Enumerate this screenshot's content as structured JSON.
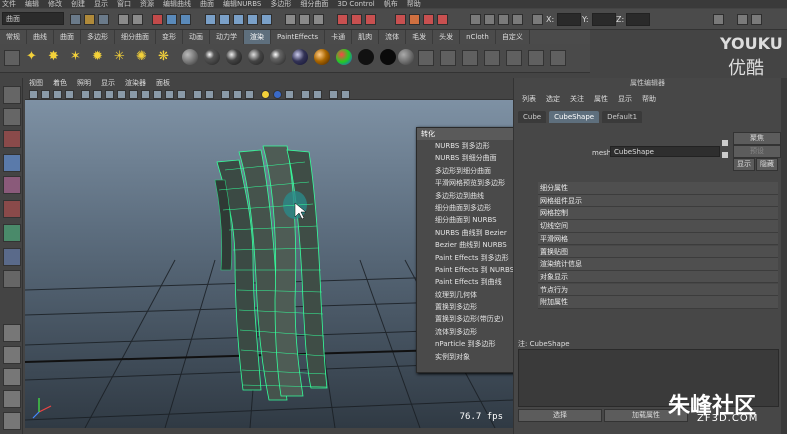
{
  "menubar": [
    "文件",
    "编辑",
    "修改",
    "创建",
    "显示",
    "窗口",
    "资源",
    "编辑曲线",
    "曲面",
    "编辑NURBS",
    "多边形",
    "细分曲面",
    "3D Control",
    "帆布",
    "帮助"
  ],
  "statusline": {
    "mode": "曲面",
    "x_label": "X:",
    "y_label": "Y:",
    "z_label": "Z:"
  },
  "shelf_tabs": [
    "常规",
    "曲线",
    "曲面",
    "多边形",
    "细分曲面",
    "变形",
    "动画",
    "动力学",
    "渲染",
    "PaintEffects",
    "卡通",
    "肌肉",
    "流体",
    "毛发",
    "头发",
    "nCloth",
    "自定义"
  ],
  "active_shelf_tab": "渲染",
  "panel_menu": [
    "视图",
    "着色",
    "照明",
    "显示",
    "渲染器",
    "面板"
  ],
  "viewport": {
    "fps": "76.7 fps"
  },
  "convert_menu": {
    "title": "转化",
    "close": "x",
    "items": [
      {
        "label": "NURBS 到多边形",
        "option": true
      },
      {
        "label": "NURBS 到细分曲面",
        "option": true
      },
      {
        "label": "多边形到细分曲面",
        "option": true
      },
      {
        "label": "平滑网格预览到多边形",
        "option": true
      },
      {
        "label": "多边形边到曲线",
        "option": true
      },
      {
        "label": "细分曲面到多边形",
        "option": true
      },
      {
        "label": "细分曲面到 NURBS",
        "option": true
      },
      {
        "label": "NURBS 曲线到 Bezier",
        "option": false
      },
      {
        "label": "Bezier 曲线到 NURBS",
        "option": false
      },
      {
        "label": "Paint Effects 到多边形",
        "option": true
      },
      {
        "label": "Paint Effects 到 NURBS",
        "option": true
      },
      {
        "label": "Paint Effects 到曲线",
        "option": true
      },
      {
        "label": "纹理到几何体",
        "option": true
      },
      {
        "label": "置换到多边形",
        "option": false
      },
      {
        "label": "置换到多边形(带历史)",
        "option": false
      },
      {
        "label": "流体到多边形",
        "option": false
      },
      {
        "label": "nParticle 到多边形",
        "option": true
      },
      {
        "label": "实例到对象",
        "option": false
      }
    ]
  },
  "attr_editor": {
    "title": "属性编辑器",
    "menu": [
      "列表",
      "选定",
      "关注",
      "属性",
      "显示",
      "帮助"
    ],
    "tabs": [
      "Cube",
      "CubeShape",
      "Default1"
    ],
    "active_tab": "CubeShape",
    "mesh_label": "mesh:",
    "mesh_value": "CubeShape",
    "focus_btn": "聚焦",
    "preset_btn": "预设",
    "show_btn": "显示",
    "hide_btn": "隐藏",
    "sections": [
      "细分属性",
      "网格组件显示",
      "网格控制",
      "切线空间",
      "平滑网格",
      "置换贴图",
      "渲染统计信息",
      "对象显示",
      "节点行为",
      "附加属性"
    ],
    "notes_label": "注: CubeShape",
    "select_btn": "选择",
    "load_btn": "加载属性"
  },
  "watermarks": {
    "youku_en": "YOUKU",
    "youku_cn": "优酷",
    "site_cn": "朱峰社区",
    "site_en": "ZF3D.COM"
  },
  "colors": {
    "accent": "#5e6f7d",
    "wire": "#34ff9a",
    "close": "#c75a2a"
  }
}
